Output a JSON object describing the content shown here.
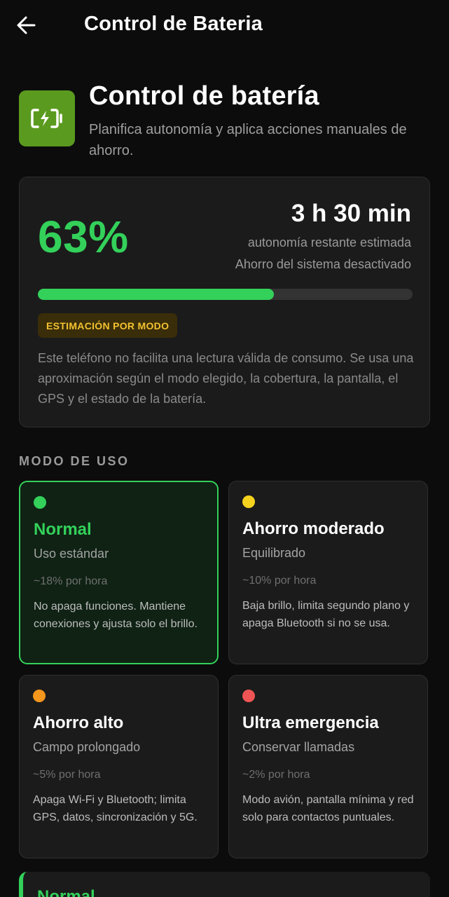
{
  "topbar": {
    "title": "Control de Bateria",
    "back_icon": "arrow-left-icon"
  },
  "hero": {
    "icon": "battery-charging-icon",
    "icon_color": "#5a9a1e",
    "title": "Control de batería",
    "subtitle": "Planifica autonomía y aplica acciones manuales de ahorro."
  },
  "status": {
    "percent_label": "63%",
    "level_percent": 63,
    "time_remaining": "3 h 30 min",
    "autonomy_label": "autonomía restante estimada",
    "system_saver": "Ahorro del sistema desactivado",
    "badge": "ESTIMACIÓN POR MODO",
    "note": "Este teléfono no facilita una lectura válida de consumo. Se usa una aproximación según el modo elegido, la cobertura, la pantalla, el GPS y el estado de la batería."
  },
  "modes_section": {
    "label": "MODO DE USO",
    "modes": [
      {
        "name": "Normal",
        "subtitle": "Uso estándar",
        "rate": "~18% por hora",
        "description": "No apaga funciones. Mantiene conexiones y ajusta solo el brillo.",
        "color": "#33d15a",
        "selected": true
      },
      {
        "name": "Ahorro moderado",
        "subtitle": "Equilibrado",
        "rate": "~10% por hora",
        "description": "Baja brillo, limita segundo plano y apaga Bluetooth si no se usa.",
        "color": "#f5d21d",
        "selected": false
      },
      {
        "name": "Ahorro alto",
        "subtitle": "Campo prolongado",
        "rate": "~5% por hora",
        "description": "Apaga Wi-Fi y Bluetooth; limita GPS, datos, sincronización y 5G.",
        "color": "#f5961d",
        "selected": false
      },
      {
        "name": "Ultra emergencia",
        "subtitle": "Conservar llamadas",
        "rate": "~2% por hora",
        "description": "Modo avión, pantalla mínima y red solo para contactos puntuales.",
        "color": "#f05454",
        "selected": false
      }
    ]
  },
  "active_mode": {
    "title": "Normal"
  },
  "colors": {
    "background": "#0c0c0c",
    "card": "#1b1b1b",
    "accent_green": "#33d15a",
    "badge_text": "#f2c230"
  }
}
